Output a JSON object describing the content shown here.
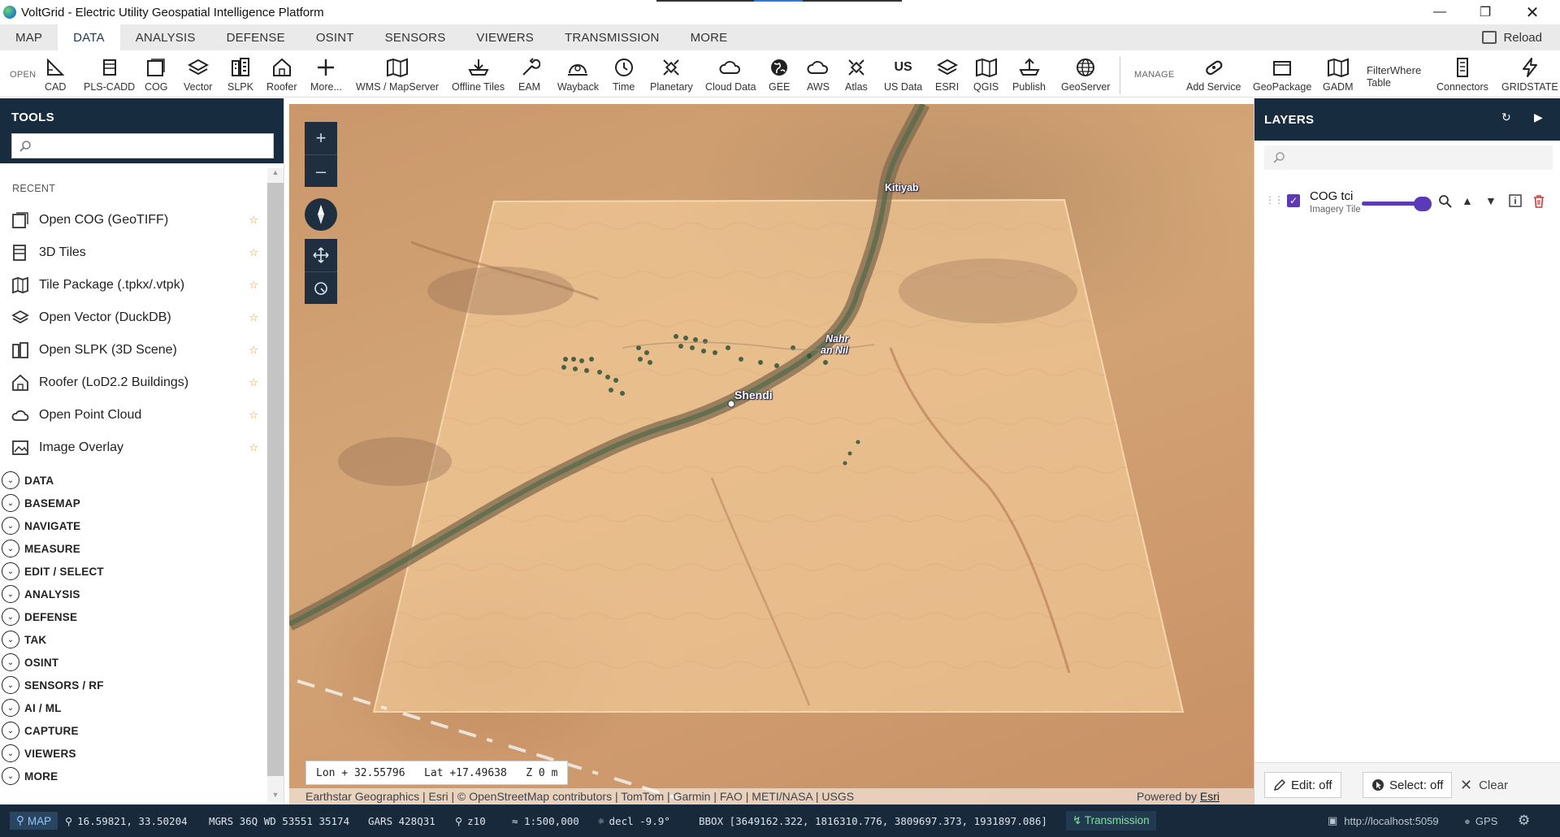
{
  "window": {
    "title": "VoltGrid - Electric Utility Geospatial Intelligence Platform",
    "controls": [
      "minimize",
      "restore",
      "close"
    ]
  },
  "menu": {
    "tabs": [
      "MAP",
      "DATA",
      "ANALYSIS",
      "DEFENSE",
      "OSINT",
      "SENSORS",
      "VIEWERS",
      "TRANSMISSION",
      "MORE"
    ],
    "active": "DATA",
    "reload_label": "Reload"
  },
  "toolbar": {
    "open_label": "OPEN",
    "manage_label": "MANAGE",
    "open_items": [
      "CAD",
      "PLS-CADD",
      "COG",
      "Vector",
      "SLPK",
      "Roofer",
      "More...",
      "WMS / MapServer",
      "Offline Tiles",
      "EAM",
      "Wayback",
      "Time",
      "Planetary",
      "Cloud Data",
      "GEE",
      "AWS",
      "Atlas",
      "US Data",
      "ESRI",
      "QGIS",
      "Publish",
      "GeoServer"
    ],
    "us_data_icon_text": "US",
    "manage_items": [
      "Add Service",
      "GeoPackage",
      "GADM",
      "FilterWhere",
      "Table",
      "Connectors",
      "GRIDSTATE"
    ]
  },
  "tools": {
    "title": "TOOLS",
    "search_placeholder": "",
    "recent_label": "RECENT",
    "recent": [
      {
        "label": "Open COG (GeoTIFF)",
        "icon": "cog-icon"
      },
      {
        "label": "3D Tiles",
        "icon": "tiles-3d-icon"
      },
      {
        "label": "Tile Package (.tpkx/.vtpk)",
        "icon": "tile-package-icon"
      },
      {
        "label": "Open Vector (DuckDB)",
        "icon": "vector-icon"
      },
      {
        "label": "Open SLPK (3D Scene)",
        "icon": "slpk-icon"
      },
      {
        "label": "Roofer (LoD2.2 Buildings)",
        "icon": "roofer-icon"
      },
      {
        "label": "Open Point Cloud",
        "icon": "cloud-icon"
      },
      {
        "label": "Image Overlay",
        "icon": "image-overlay-icon"
      }
    ],
    "sections": [
      "DATA",
      "BASEMAP",
      "NAVIGATE",
      "MEASURE",
      "EDIT / SELECT",
      "ANALYSIS",
      "DEFENSE",
      "TAK",
      "OSINT",
      "SENSORS / RF",
      "AI / ML",
      "CAPTURE",
      "VIEWERS",
      "MORE"
    ]
  },
  "map": {
    "places": [
      "Kitiyab",
      "Nahr",
      "an Nil",
      "Shendi"
    ],
    "coords_readout": "Lon + 32.55796   Lat +17.49638   Z 0 m",
    "attribution": "Earthstar Geographics | Esri | © OpenStreetMap contributors | TomTom | Garmin | FAO | METI/NASA | USGS",
    "powered_by_prefix": "Powered by ",
    "powered_by_link": "Esri"
  },
  "layers": {
    "title": "LAYERS",
    "search_placeholder": "",
    "items": [
      {
        "name": "COG tci",
        "subtitle": "Imagery Tile",
        "checked": true,
        "opacity": 1.0
      }
    ],
    "edit_label": "Edit: off",
    "select_label": "Select: off",
    "clear_label": "Clear"
  },
  "status": {
    "map_label": "MAP",
    "latlon": "16.59821, 33.50204",
    "mgrs": "MGRS 36Q WD 53551 35174",
    "gars": "GARS 428Q31",
    "zoom": "z10",
    "scale": "≈ 1:500,000",
    "decl": "decl -9.9°",
    "bbox": "BBOX [3649162.322, 1816310.776, 3809697.373, 1931897.086]",
    "transmission": "Transmission",
    "server": "http://localhost:5059",
    "gps": "GPS"
  },
  "colors": {
    "panel_header": "#182c3f",
    "status_bar": "#17293b",
    "accent_purple": "#5b3ab8",
    "transmission_green": "#7ee29a",
    "star": "#d8a020"
  }
}
